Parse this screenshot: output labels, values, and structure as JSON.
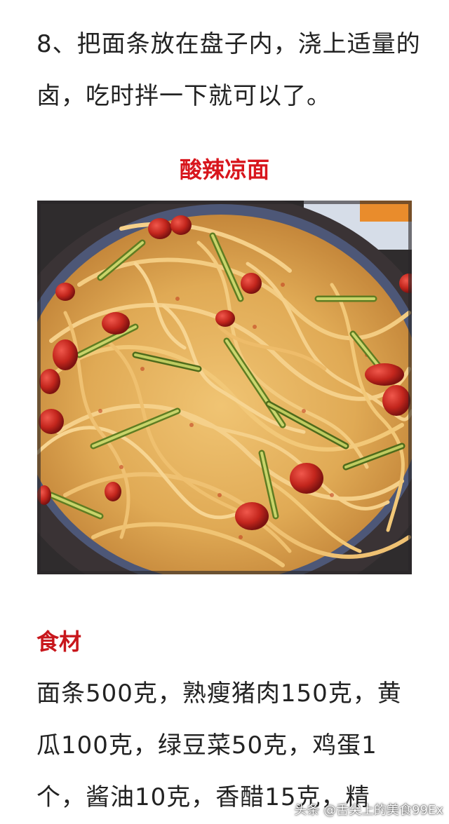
{
  "step": {
    "text": "8、把面条放在盘子内，浇上适量的卤，吃时拌一下就可以了。"
  },
  "recipe": {
    "title": "酸辣凉面"
  },
  "photo": {
    "subject": "酸辣凉面 photo",
    "colors": {
      "bowl": "#2b2a2c",
      "noodle": "#e3b45a",
      "cucumber": "#6d8b2a",
      "peanut": "#c3261d"
    }
  },
  "ingredients": {
    "heading": "食材",
    "text": "面条500克，熟瘦猪肉150克，黄瓜100克，绿豆菜50克，鸡蛋1个，酱油10克，香醋15克，精"
  },
  "watermark": {
    "text": "头条 @舌尖上的美食99Ex"
  },
  "colors": {
    "accent_red": "#d8161d",
    "body_text": "#222222"
  }
}
